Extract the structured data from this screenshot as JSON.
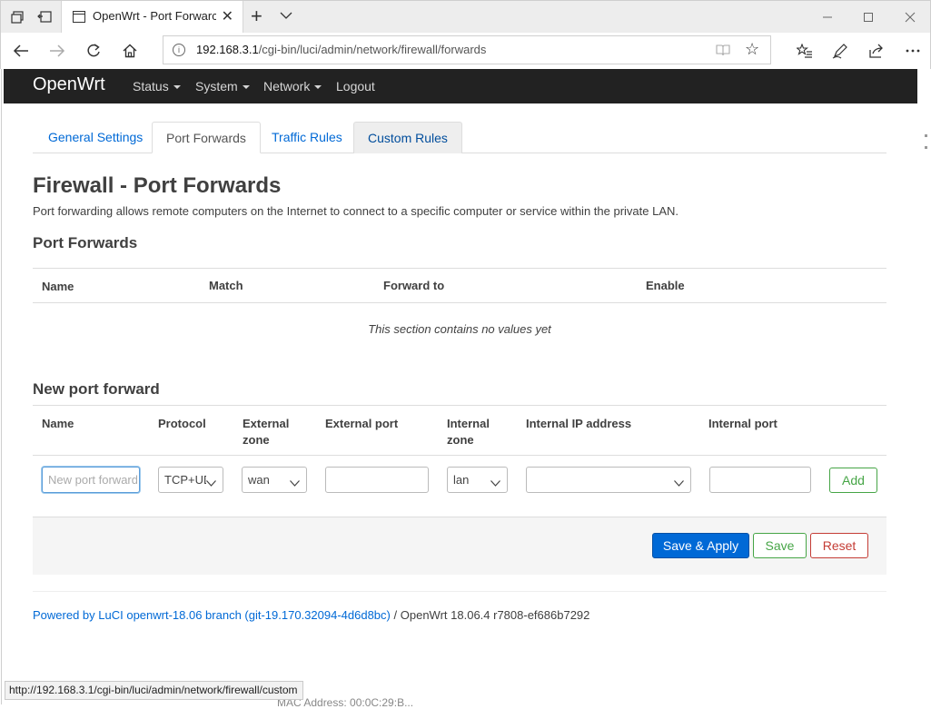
{
  "browser": {
    "tab_title": "OpenWrt - Port Forwarc",
    "url_host": "192.168.3.1",
    "url_path": "/cgi-bin/luci/admin/network/firewall/forwards",
    "status_url": "http://192.168.3.1/cgi-bin/luci/admin/network/firewall/custom"
  },
  "header": {
    "brand": "OpenWrt",
    "menu": [
      "Status",
      "System",
      "Network",
      "Logout"
    ]
  },
  "tabs": [
    "General Settings",
    "Port Forwards",
    "Traffic Rules",
    "Custom Rules"
  ],
  "page": {
    "title": "Firewall - Port Forwards",
    "description": "Port forwarding allows remote computers on the Internet to connect to a specific computer or service within the private LAN."
  },
  "port_forwards": {
    "heading": "Port Forwards",
    "columns": [
      "Name",
      "Match",
      "Forward to",
      "Enable"
    ],
    "empty_message": "This section contains no values yet"
  },
  "new_forward": {
    "heading": "New port forward",
    "columns": [
      "Name",
      "Protocol",
      "External\nzone",
      "External port",
      "Internal\nzone",
      "Internal IP address",
      "Internal port"
    ],
    "name_placeholder": "New port forward",
    "protocol": "TCP+UDP",
    "external_zone": "wan",
    "external_port": "",
    "internal_zone": "lan",
    "internal_ip": "",
    "internal_port": "",
    "add_label": "Add"
  },
  "actions": {
    "save_apply": "Save & Apply",
    "save": "Save",
    "reset": "Reset"
  },
  "footer": {
    "link": "Powered by LuCI openwrt-18.06 branch (git-19.170.32094-4d6d8bc)",
    "separator": "/",
    "version": "OpenWrt 18.06.4 r7808-ef686b7292"
  },
  "bottom_peek": "MAC Address:  00:0C:29:B..."
}
